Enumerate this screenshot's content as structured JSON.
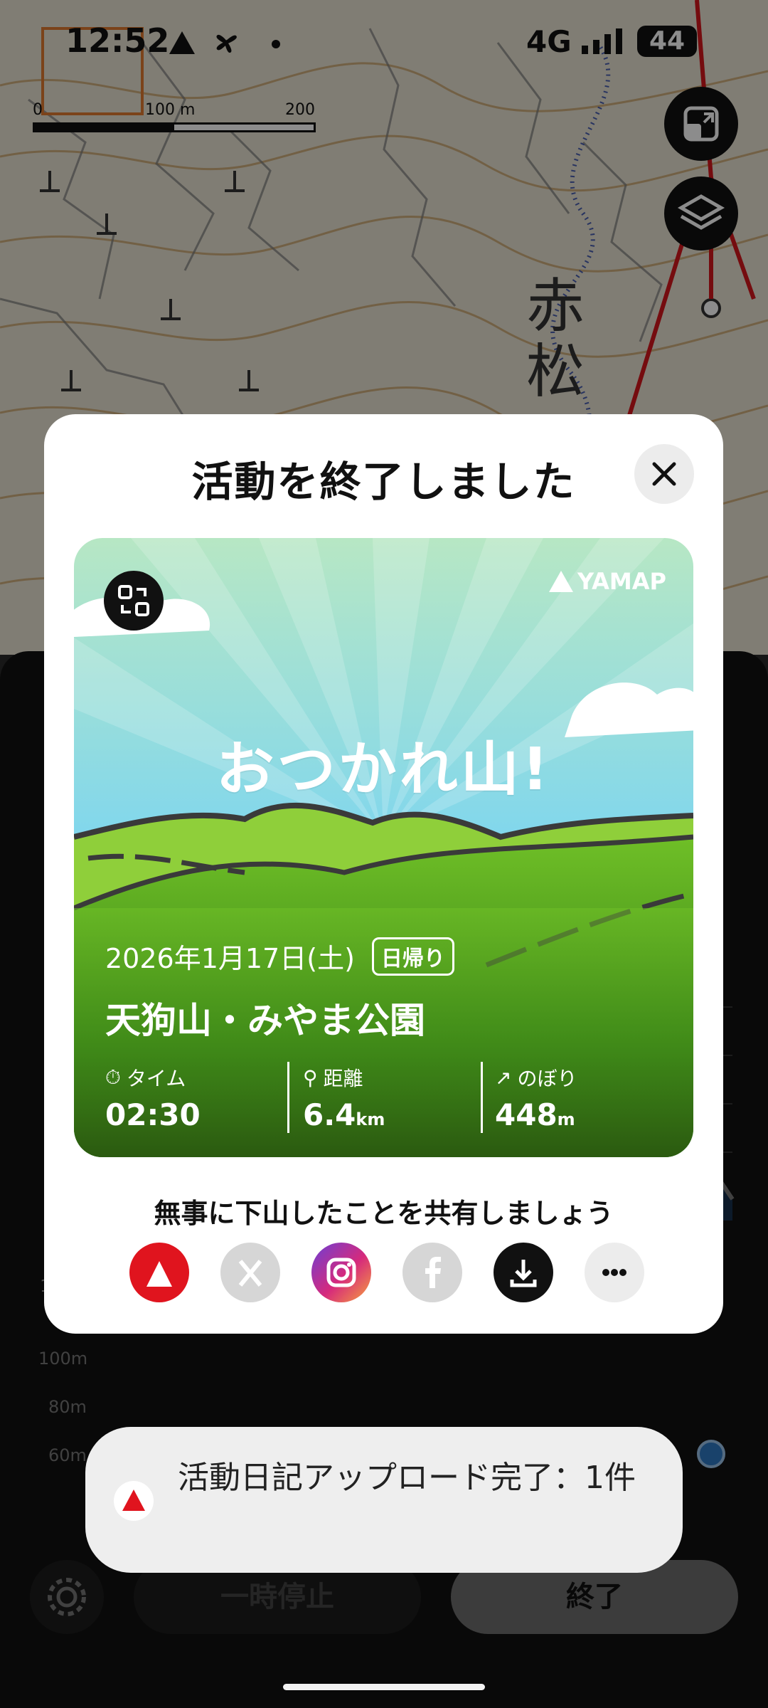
{
  "status_bar": {
    "time": "12:52",
    "network": "4G",
    "battery": "44"
  },
  "map": {
    "scale": {
      "zero": "0",
      "mid": "100 m",
      "max": "200 m"
    },
    "place_label": "赤松"
  },
  "modal": {
    "title": "活動を終了しました",
    "card": {
      "headline": "おつかれ山!",
      "brand": "YAMAP",
      "date": "2026年1月17日(土)",
      "trip_badge": "日帰り",
      "location": "天狗山・みやま公園",
      "stats": [
        {
          "label": "タイム",
          "value": "02:30",
          "unit": ""
        },
        {
          "label": "距離",
          "value": "6.4",
          "unit": "km"
        },
        {
          "label": "のぼり",
          "value": "448",
          "unit": "m"
        }
      ]
    },
    "share_prompt": "無事に下山したことを共有しましょう",
    "share_buttons": [
      "yamap-share-icon",
      "x-share-icon",
      "instagram-share-icon",
      "facebook-share-icon",
      "download-icon",
      "more-icon"
    ]
  },
  "elevation": {
    "y_ticks": [
      "100m",
      "80m",
      "60m"
    ]
  },
  "controls": {
    "pause_label": "一時停止",
    "end_label": "終了"
  },
  "toast": {
    "message": "活動日記アップロード完了：1件"
  },
  "colors": {
    "brand_red": "#e0141e",
    "card_green": "#5aa51d",
    "sky_blue": "#6dcff0"
  }
}
